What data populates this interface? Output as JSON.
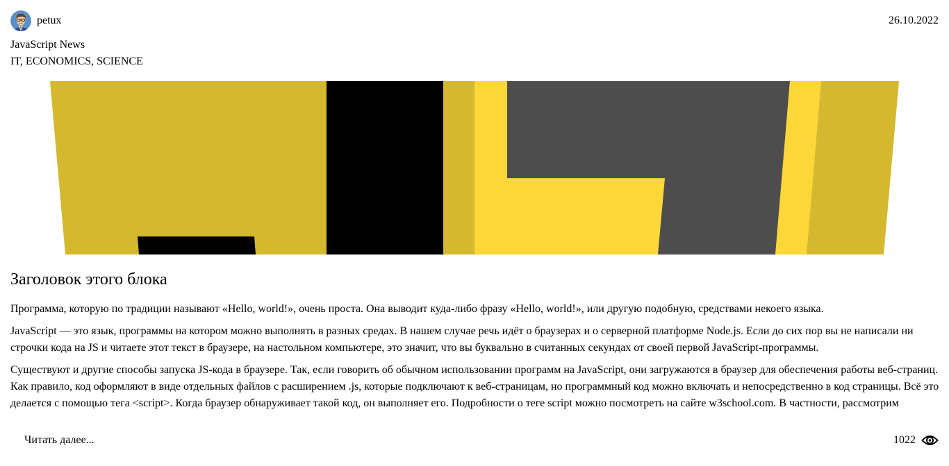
{
  "author": {
    "name": "petux",
    "avatar_icon": "avatar-cartoon-man-icon"
  },
  "date": "26.10.2022",
  "blog": {
    "name": "JavaScript News",
    "tags": "IT, ECONOMICS, SCIENCE"
  },
  "banner": {
    "icon": "javascript-logo-banner",
    "colors": {
      "yellow_dark": "#D4B830",
      "yellow_light": "#FCD73A",
      "black": "#000000",
      "gray": "#4D4D4D"
    }
  },
  "article": {
    "title": "Заголовок этого блока",
    "paragraphs": [
      "Программа, которую по традиции называют «Hello, world!», очень проста. Она выводит куда-либо фразу «Hello, world!», или другую подобную, средствами некоего языка.",
      "JavaScript — это язык, программы на котором можно выполнять в разных средах. В нашем случае речь идёт о браузерах и о серверной платформе Node.js. Если до сих пор вы не написали ни строчки кода на JS и читаете этот текст в браузере, на настольном компьютере, это значит, что вы буквально в считанных секундах от своей первой JavaScript-программы.",
      "Существуют и другие способы запуска JS-кода в браузере. Так, если говорить об обычном использовании программ на JavaScript, они загружаются в браузер для обеспечения работы веб-страниц. Как правило, код оформляют в виде отдельных файлов с расширением .js, которые подключают к веб-страницам, но программный код можно включать и непосредственно в код страницы. Всё это делается с помощью тега <script>. Когда браузер обнаруживает такой код, он выполняет его. Подробности о теге script можно посмотреть на сайте w3school.com. В частности, рассмотрим"
    ]
  },
  "footer": {
    "read_more": "Читать далее...",
    "views": "1022",
    "views_icon": "eye-icon"
  }
}
